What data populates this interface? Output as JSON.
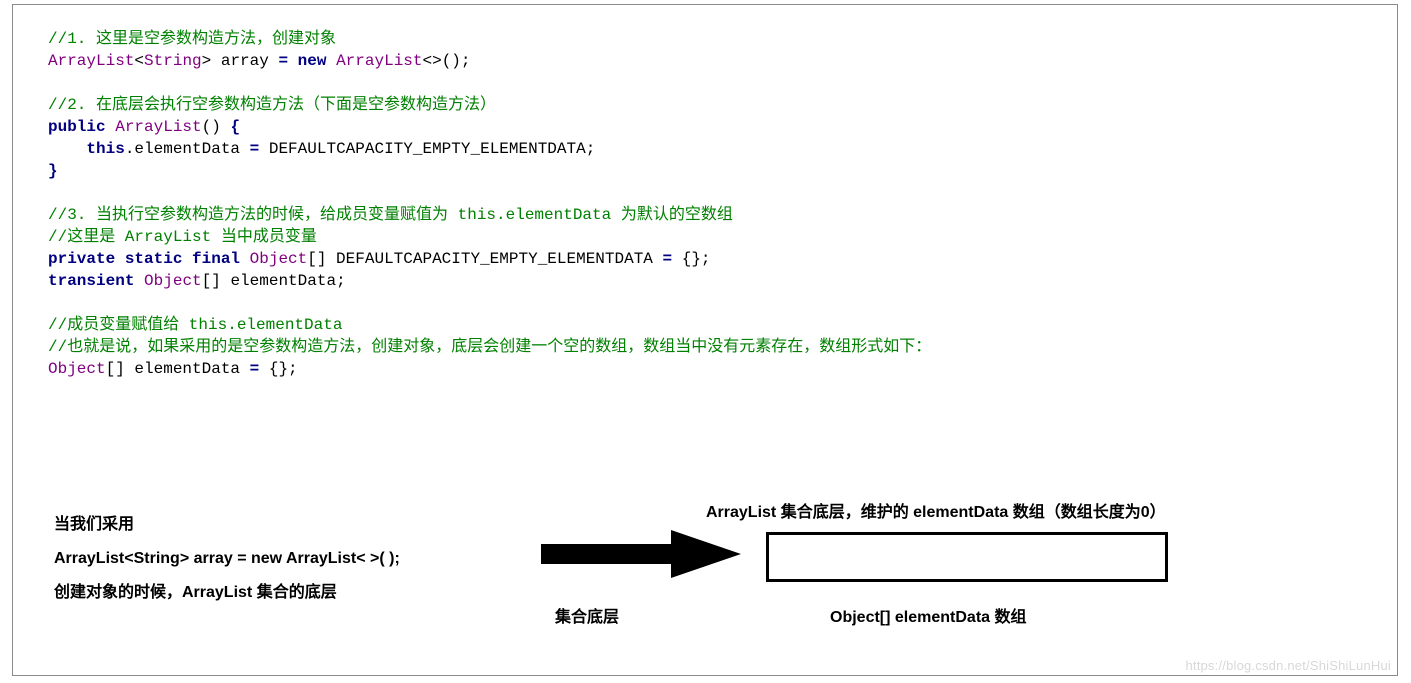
{
  "code": {
    "l01": "//1. 这里是空参数构造方法，创建对象",
    "l02a": "ArrayList",
    "l02b": "<",
    "l02c": "String",
    "l02d": "> array ",
    "l02e": "= ",
    "l02f": "new",
    "l02g": " ",
    "l02h": "ArrayList",
    "l02i": "<>();",
    "l03": "",
    "l04": "//2. 在底层会执行空参数构造方法（下面是空参数构造方法）",
    "l05a": "public",
    "l05b": " ",
    "l05c": "ArrayList",
    "l05d": "() ",
    "l05e": "{",
    "l06a": "    ",
    "l06b": "this",
    "l06c": ".elementData ",
    "l06d": "=",
    "l06e": " DEFAULTCAPACITY_EMPTY_ELEMENTDATA;",
    "l07": "}",
    "l08": "",
    "l09": "//3. 当执行空参数构造方法的时候，给成员变量赋值为 this.elementData 为默认的空数组",
    "l10": "//这里是 ArrayList 当中成员变量",
    "l11a": "private static final",
    "l11b": " ",
    "l11c": "Object",
    "l11d": "[] DEFAULTCAPACITY_EMPTY_ELEMENTDATA ",
    "l11e": "=",
    "l11f": " {};",
    "l12a": "transient",
    "l12b": " ",
    "l12c": "Object",
    "l12d": "[] elementData;",
    "l13": "",
    "l14": "//成员变量赋值给 this.elementData",
    "l15": "//也就是说，如果采用的是空参数构造方法，创建对象，底层会创建一个空的数组，数组当中没有元素存在，数组形式如下：",
    "l16a": "Object",
    "l16b": "[] elementData ",
    "l16c": "=",
    "l16d": " {};"
  },
  "diagram": {
    "left_line1": "当我们采用",
    "left_line2": "ArrayList<String>   array = new  ArrayList< >( );",
    "left_line3": "创建对象的时候，ArrayList 集合的底层",
    "arrow_label": "集合底层",
    "right_title": "ArrayList 集合底层，维护的 elementData 数组（数组长度为0）",
    "right_bottom": "Object[]   elementData 数组"
  },
  "watermark": "https://blog.csdn.net/ShiShiLunHui"
}
